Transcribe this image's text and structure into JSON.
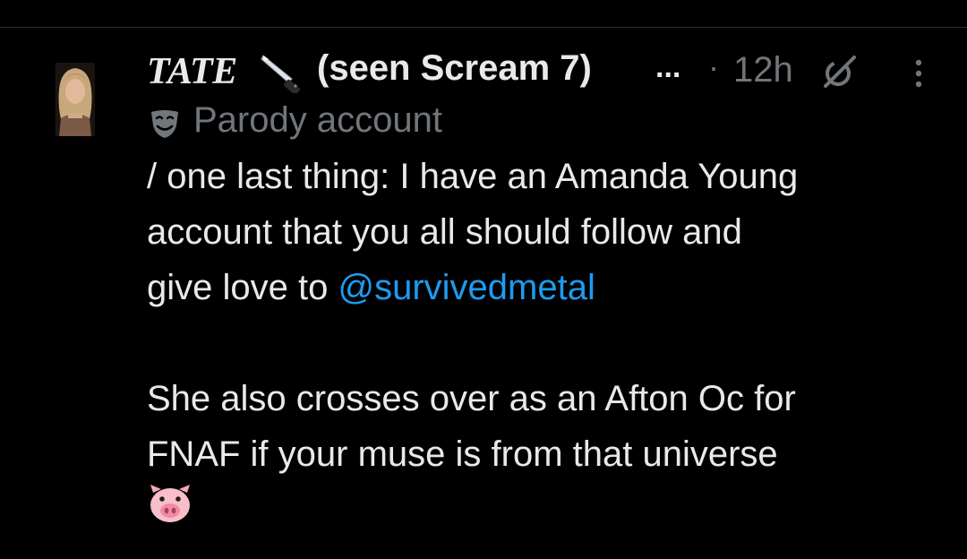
{
  "post": {
    "display_name": "TATE",
    "name_emoji": "knife-icon",
    "name_suffix": "(seen Scream 7)",
    "truncation": "...",
    "separator": "·",
    "time": "12h",
    "label": "Parody account",
    "label_icon": "theater-mask-icon",
    "text_lines": [
      "/ one last thing: I have an Amanda Young",
      "account that you all should follow and",
      "give love to "
    ],
    "mention": "@survivedmetal",
    "text_lines_2": [
      "She also crosses over as an Afton Oc for",
      "FNAF if your muse is from that universe"
    ],
    "end_emoji": "pig-face-icon"
  },
  "colors": {
    "background": "#000000",
    "primary_text": "#e7e9ea",
    "secondary_text": "#71767b",
    "link": "#1d9bf0"
  }
}
